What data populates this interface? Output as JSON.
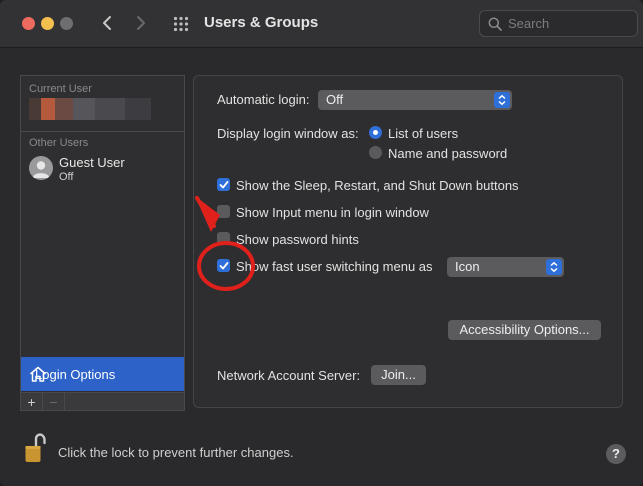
{
  "window": {
    "title": "Users & Groups"
  },
  "search": {
    "placeholder": "Search"
  },
  "sidebar": {
    "current_user_label": "Current User",
    "other_users_label": "Other Users",
    "guest": {
      "name": "Guest User",
      "status": "Off"
    },
    "login_options_label": "Login Options",
    "add_label": "+",
    "remove_label": "−"
  },
  "panel": {
    "automatic_login": {
      "label": "Automatic login:",
      "value": "Off"
    },
    "display_login": {
      "label": "Display login window as:",
      "options": [
        {
          "label": "List of users",
          "selected": true
        },
        {
          "label": "Name and password",
          "selected": false
        }
      ]
    },
    "checkboxes": [
      {
        "label": "Show the Sleep, Restart, and Shut Down buttons",
        "checked": true
      },
      {
        "label": "Show Input menu in login window",
        "checked": false
      },
      {
        "label": "Show password hints",
        "checked": false
      },
      {
        "label": "Show fast user switching menu as",
        "checked": true
      }
    ],
    "fast_switch_value": "Icon",
    "accessibility_button": "Accessibility Options...",
    "network_label": "Network Account Server:",
    "join_button": "Join..."
  },
  "footer": {
    "lock_text": "Click the lock to prevent further changes.",
    "help_label": "?"
  },
  "colors": {
    "accent": "#2f6fd9",
    "selection": "#2d63c8",
    "annotation": "#e0201b"
  }
}
